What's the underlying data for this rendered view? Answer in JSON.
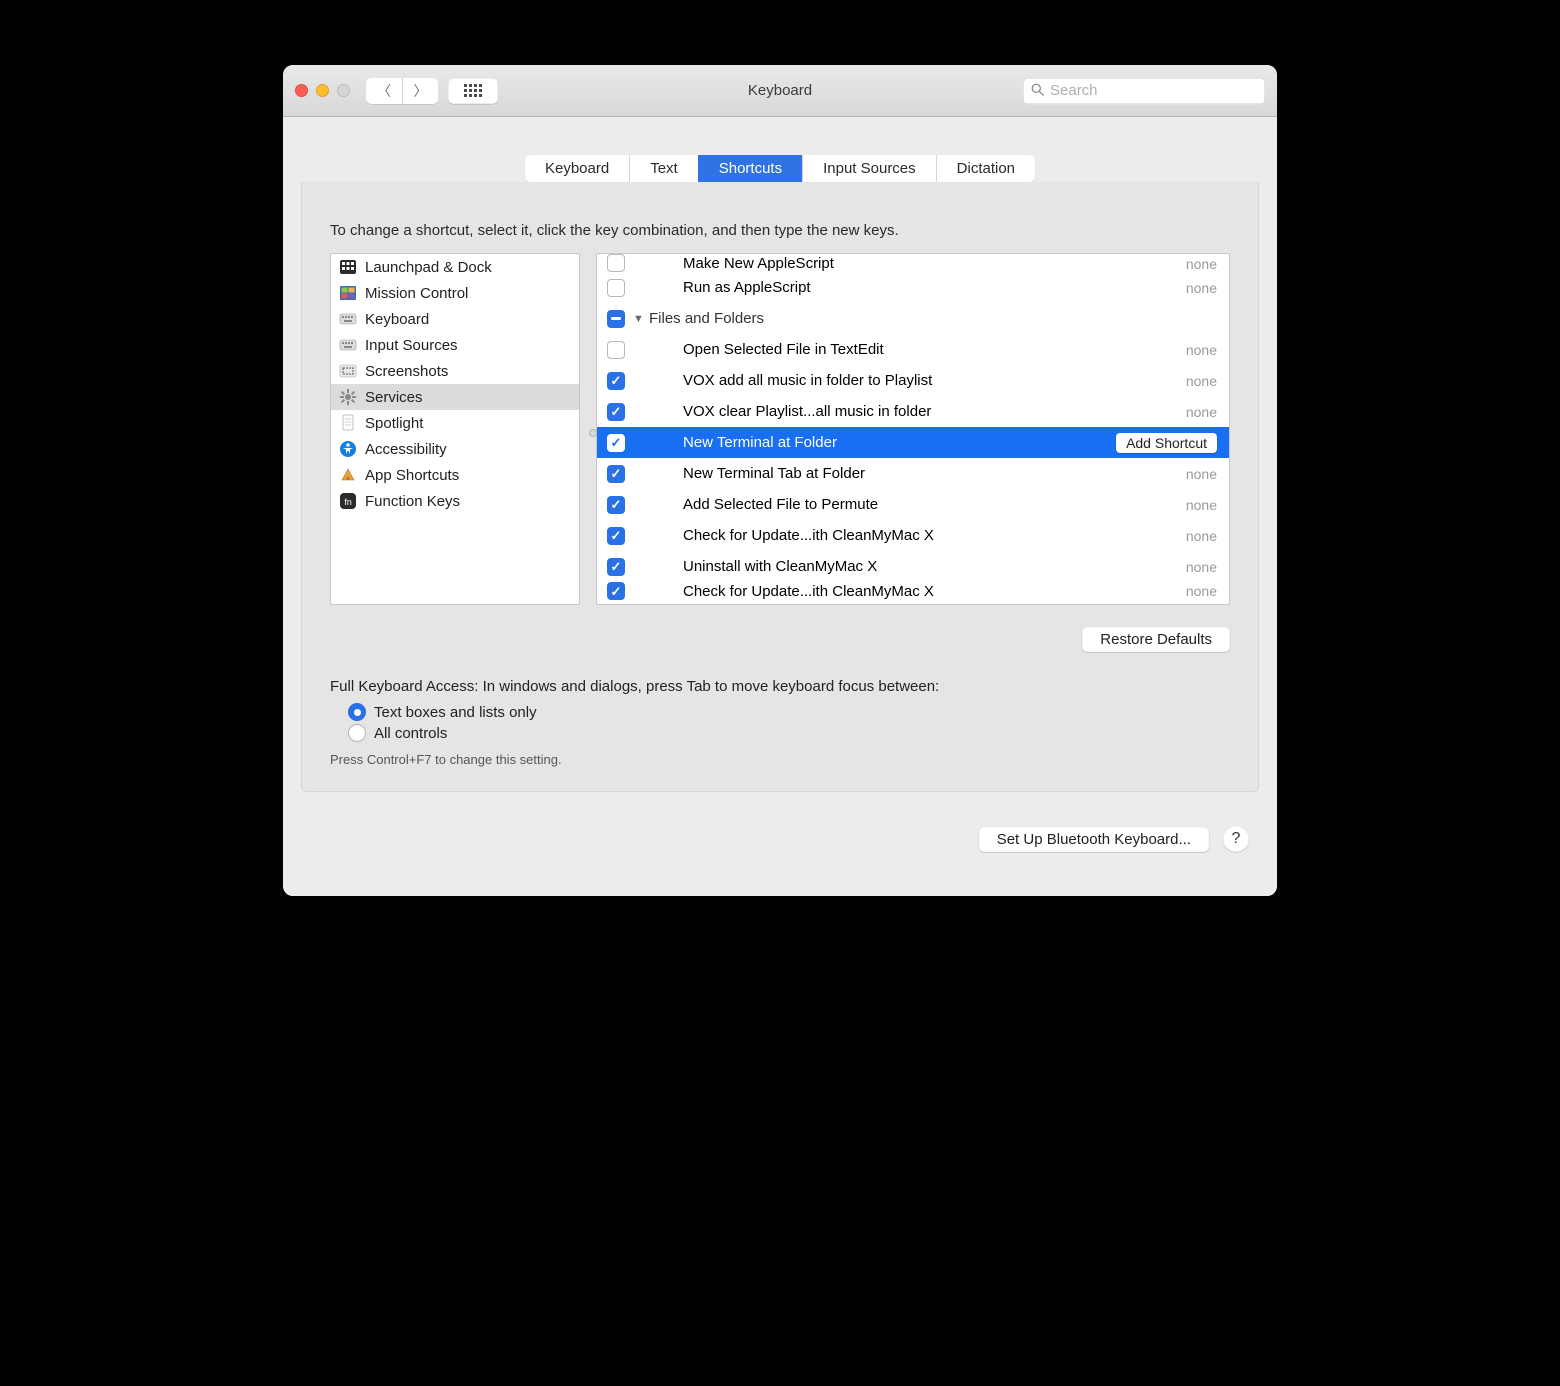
{
  "window": {
    "title": "Keyboard",
    "search_placeholder": "Search"
  },
  "tabs": [
    {
      "label": "Keyboard",
      "active": false
    },
    {
      "label": "Text",
      "active": false
    },
    {
      "label": "Shortcuts",
      "active": true
    },
    {
      "label": "Input Sources",
      "active": false
    },
    {
      "label": "Dictation",
      "active": false
    }
  ],
  "instruction": "To change a shortcut, select it, click the key combination, and then type the new keys.",
  "sidebar": {
    "items": [
      {
        "label": "Launchpad & Dock",
        "icon": "launchpad"
      },
      {
        "label": "Mission Control",
        "icon": "mission-control"
      },
      {
        "label": "Keyboard",
        "icon": "keyboard"
      },
      {
        "label": "Input Sources",
        "icon": "keyboard"
      },
      {
        "label": "Screenshots",
        "icon": "screenshots"
      },
      {
        "label": "Services",
        "icon": "gear",
        "selected": true
      },
      {
        "label": "Spotlight",
        "icon": "spotlight"
      },
      {
        "label": "Accessibility",
        "icon": "accessibility"
      },
      {
        "label": "App Shortcuts",
        "icon": "app-shortcuts"
      },
      {
        "label": "Function Keys",
        "icon": "fn"
      }
    ]
  },
  "detail": {
    "rows": [
      {
        "type": "item",
        "checked": false,
        "label": "Make New AppleScript",
        "shortcut": "none",
        "clipped": "top"
      },
      {
        "type": "item",
        "checked": false,
        "label": "Run as AppleScript",
        "shortcut": "none"
      },
      {
        "type": "group",
        "checked": "mixed",
        "label": "Files and Folders"
      },
      {
        "type": "item",
        "checked": false,
        "label": "Open Selected File in TextEdit",
        "shortcut": "none"
      },
      {
        "type": "item",
        "checked": true,
        "label": "VOX add all music in folder to Playlist",
        "shortcut": "none"
      },
      {
        "type": "item",
        "checked": true,
        "label": "VOX clear Playlist...all music in folder",
        "shortcut": "none"
      },
      {
        "type": "item",
        "checked": true,
        "label": "New Terminal at Folder",
        "shortcut": "add",
        "selected": true
      },
      {
        "type": "item",
        "checked": true,
        "label": "New Terminal Tab at Folder",
        "shortcut": "none"
      },
      {
        "type": "item",
        "checked": true,
        "label": "Add Selected File to Permute",
        "shortcut": "none"
      },
      {
        "type": "item",
        "checked": true,
        "label": "Check for Update...ith CleanMyMac X",
        "shortcut": "none"
      },
      {
        "type": "item",
        "checked": true,
        "label": "Uninstall with CleanMyMac X",
        "shortcut": "none"
      },
      {
        "type": "item",
        "checked": true,
        "label": "Check for Update...ith CleanMyMac X",
        "shortcut": "none",
        "clipped": "bottom"
      }
    ],
    "add_shortcut_label": "Add Shortcut",
    "none_label": "none"
  },
  "restore_defaults_label": "Restore Defaults",
  "fka": {
    "heading": "Full Keyboard Access: In windows and dialogs, press Tab to move keyboard focus between:",
    "option1": "Text boxes and lists only",
    "option2": "All controls",
    "hint": "Press Control+F7 to change this setting."
  },
  "bluetooth_label": "Set Up Bluetooth Keyboard...",
  "help_label": "?"
}
